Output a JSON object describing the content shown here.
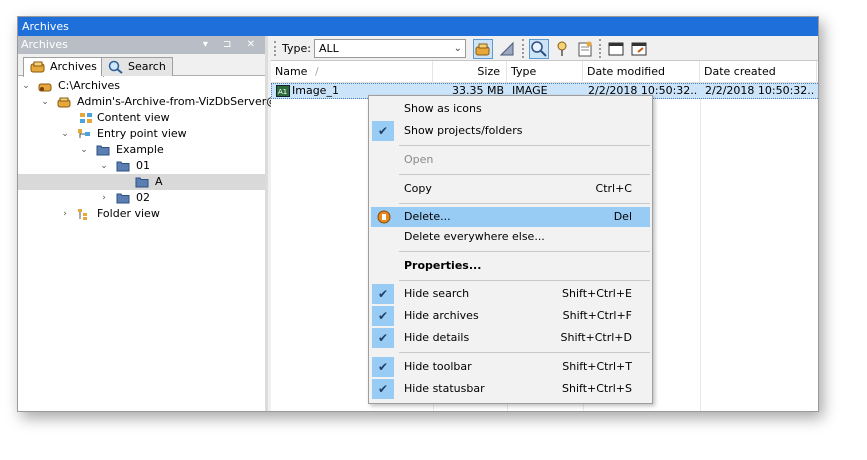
{
  "window": {
    "title": "Archives"
  },
  "panel": {
    "title": "Archives",
    "header_icons": "▾ ⊐ ✕"
  },
  "tabs": [
    {
      "label": "Archives",
      "icon": "archive-icon"
    },
    {
      "label": "Search",
      "icon": "magnifier-icon"
    }
  ],
  "tree": [
    {
      "label": "C:\\Archives",
      "icon": "archive-root-icon",
      "chevron": "expanded"
    },
    {
      "label": "Admin's-Archive-from-VizDbServer@GH",
      "icon": "archive-icon",
      "chevron": "expanded"
    },
    {
      "label": "Content view",
      "icon": "content-view-icon",
      "chevron": ""
    },
    {
      "label": "Entry point view",
      "icon": "entry-point-icon",
      "chevron": "expanded"
    },
    {
      "label": "Example",
      "icon": "folder-icon",
      "chevron": "expanded"
    },
    {
      "label": "01",
      "icon": "folder-icon",
      "chevron": "expanded"
    },
    {
      "label": "A",
      "icon": "folder-icon",
      "chevron": ""
    },
    {
      "label": "02",
      "icon": "folder-icon",
      "chevron": "collapsed"
    },
    {
      "label": "Folder view",
      "icon": "folder-view-icon",
      "chevron": "collapsed"
    }
  ],
  "toolbar": {
    "type_label": "Type:",
    "type_value": "ALL",
    "buttons": [
      "archive-filter-icon",
      "chart-icon",
      "search-icon",
      "pin-icon",
      "details-icon",
      "window-icon",
      "export-icon"
    ]
  },
  "columns": [
    "Name",
    "Size",
    "Type",
    "Date modified",
    "Date created"
  ],
  "sort_indicator": "/",
  "files": [
    {
      "name": "Image_1",
      "size": "33.35 MB",
      "type": "IMAGE",
      "modified": "2/2/2018 10:50:32...",
      "created": "2/2/2018 10:50:32..."
    }
  ],
  "menu": {
    "items": [
      {
        "label": "Show as icons",
        "shortcut": "",
        "checked": false
      },
      {
        "label": "Show projects/folders",
        "shortcut": "",
        "checked": true
      },
      {
        "label": "Open",
        "shortcut": "",
        "checked": false,
        "disabled": true
      },
      {
        "label": "Copy",
        "shortcut": "Ctrl+C",
        "checked": false
      },
      {
        "label": "Delete...",
        "shortcut": "Del",
        "checked": false,
        "highlighted": true,
        "icon": "delete-icon"
      },
      {
        "label": "Delete everywhere else...",
        "shortcut": "",
        "checked": false
      },
      {
        "label": "Properties...",
        "shortcut": "",
        "checked": false,
        "bold": true
      },
      {
        "label": "Hide search",
        "shortcut": "Shift+Ctrl+E",
        "checked": true
      },
      {
        "label": "Hide archives",
        "shortcut": "Shift+Ctrl+F",
        "checked": true
      },
      {
        "label": "Hide details",
        "shortcut": "Shift+Ctrl+D",
        "checked": true
      },
      {
        "label": "Hide toolbar",
        "shortcut": "Shift+Ctrl+T",
        "checked": true
      },
      {
        "label": "Hide statusbar",
        "shortcut": "Shift+Ctrl+S",
        "checked": true
      }
    ]
  },
  "colors": {
    "titlebar": "#1e6fd9",
    "highlight": "#99ccf5",
    "selected_row": "#cce4fa",
    "panel_header": "#b9bec6"
  }
}
